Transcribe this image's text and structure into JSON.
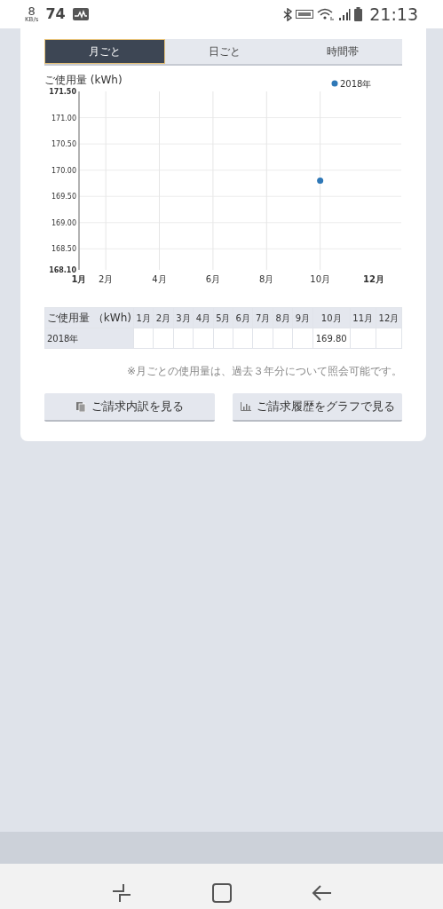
{
  "status_bar": {
    "speed": "8",
    "speed_unit": "KB/s",
    "count": "74",
    "time": "21:13"
  },
  "tabs": [
    {
      "label": "月ごと",
      "selected": true
    },
    {
      "label": "日ごと",
      "selected": false
    },
    {
      "label": "時間帯",
      "selected": false
    }
  ],
  "chart": {
    "chart_data": {
      "type": "scatter",
      "ylabel": "ご使用量 (kWh)",
      "x": [
        10
      ],
      "series": [
        {
          "name": "2018年",
          "color": "#2f78b7",
          "values": [
            169.8
          ]
        }
      ],
      "grid": true,
      "xlim": [
        1,
        12
      ],
      "ylim": [
        168.1,
        171.5
      ],
      "xticks": [
        {
          "value": 1,
          "label": "1月"
        },
        {
          "value": 2,
          "label": "2月"
        },
        {
          "value": 4,
          "label": "4月"
        },
        {
          "value": 6,
          "label": "6月"
        },
        {
          "value": 8,
          "label": "8月"
        },
        {
          "value": 10,
          "label": "10月"
        },
        {
          "value": 12,
          "label": "12月"
        }
      ],
      "yticks": [
        {
          "value": 171.5,
          "label": "171.50"
        },
        {
          "value": 171,
          "label": "171.00"
        },
        {
          "value": 170.5,
          "label": "170.50"
        },
        {
          "value": 170,
          "label": "170.00"
        },
        {
          "value": 169.5,
          "label": "169.50"
        },
        {
          "value": 169,
          "label": "169.00"
        },
        {
          "value": 168.5,
          "label": "168.50"
        },
        {
          "value": 168.1,
          "label": "168.10"
        }
      ]
    }
  },
  "table": {
    "columns": [
      "ご使用量 （kWh)",
      "1月",
      "2月",
      "3月",
      "4月",
      "5月",
      "6月",
      "7月",
      "8月",
      "9月",
      "10月",
      "11月",
      "12月"
    ],
    "rows": [
      {
        "cells": [
          "2018年",
          "",
          "",
          "",
          "",
          "",
          "",
          "",
          "",
          "",
          "169.80",
          "",
          ""
        ]
      }
    ]
  },
  "note": "※月ごとの使用量は、過去３年分について照会可能です。",
  "buttons": [
    {
      "label": "ご請求内訳を見る",
      "kind": "document"
    },
    {
      "label": "ご請求履歴をグラフで見る",
      "kind": "chart"
    }
  ]
}
